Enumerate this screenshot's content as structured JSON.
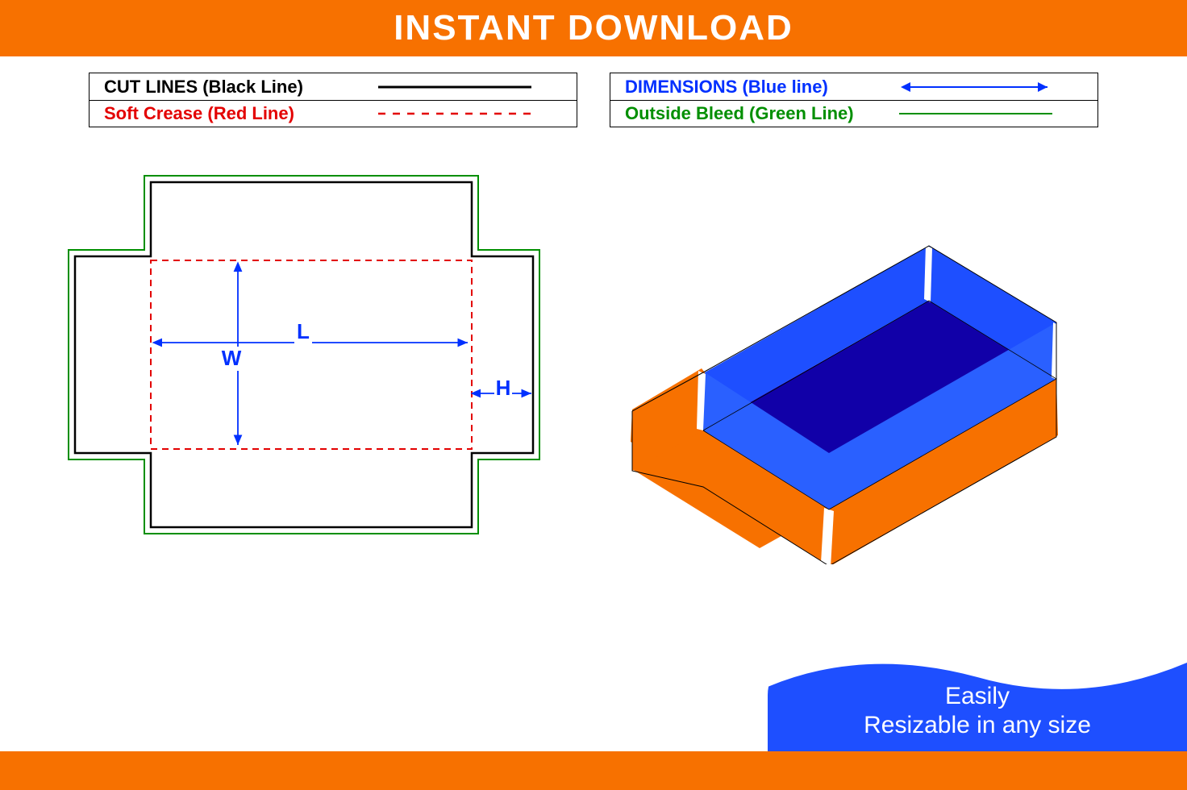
{
  "header": {
    "title": "INSTANT DOWNLOAD"
  },
  "legend": {
    "left": {
      "row1": "CUT LINES (Black Line)",
      "row2": "Soft Crease (Red Line)"
    },
    "right": {
      "row1": "DIMENSIONS (Blue line)",
      "row2": "Outside Bleed (Green Line)"
    }
  },
  "dimensions": {
    "l": "L",
    "w": "W",
    "h": "H"
  },
  "callout": {
    "line1": "Easily",
    "line2": "Resizable in any size"
  },
  "colors": {
    "orange": "#F77100",
    "blue": "#1E4FFF",
    "darkblue": "#1500C7",
    "red": "#E30000",
    "green": "#008F00",
    "dimBlue": "#0030FF"
  },
  "chart_data": {
    "type": "diagram",
    "title": "Box dieline template with 3D render",
    "parameters": [
      "L",
      "W",
      "H"
    ],
    "line_types": [
      {
        "name": "Cut Lines",
        "color": "black",
        "style": "solid"
      },
      {
        "name": "Soft Crease",
        "color": "red",
        "style": "dashed"
      },
      {
        "name": "Dimensions",
        "color": "blue",
        "style": "arrow"
      },
      {
        "name": "Outside Bleed",
        "color": "green",
        "style": "solid"
      }
    ]
  }
}
